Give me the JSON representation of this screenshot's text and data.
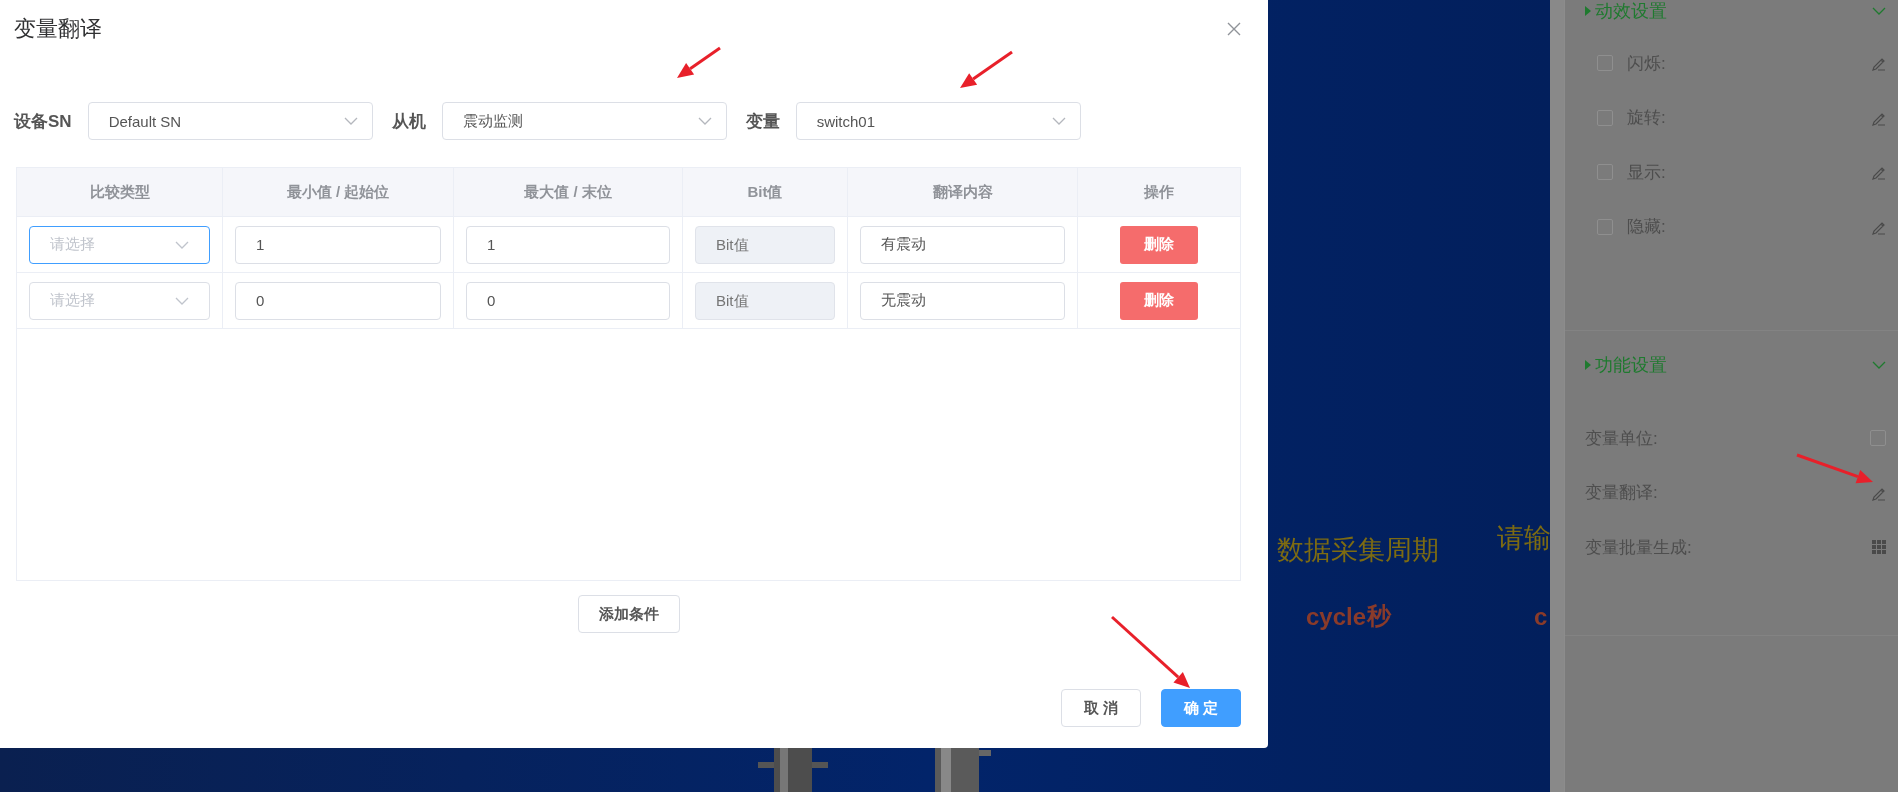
{
  "dialog": {
    "title": "变量翻译",
    "filters": [
      {
        "label": "设备SN",
        "value": "Default SN"
      },
      {
        "label": "从机",
        "value": "震动监测"
      },
      {
        "label": "变量",
        "value": "switch01"
      }
    ],
    "table": {
      "columns": [
        "比较类型",
        "最小值 / 起始位",
        "最大值 / 末位",
        "Bit值",
        "翻译内容",
        "操作"
      ],
      "rows": [
        {
          "compare_type": {
            "placeholder": "请选择",
            "focused": true
          },
          "min": "1",
          "max": "1",
          "bit": {
            "placeholder": "Bit值",
            "disabled": true
          },
          "translation": "有震动",
          "action": "删除"
        },
        {
          "compare_type": {
            "placeholder": "请选择",
            "focused": false
          },
          "min": "0",
          "max": "0",
          "bit": {
            "placeholder": "Bit值",
            "disabled": true
          },
          "translation": "无震动",
          "action": "删除"
        }
      ]
    },
    "add_button": "添加条件",
    "buttons": [
      {
        "label": "取 消",
        "kind": "default"
      },
      {
        "label": "确 定",
        "kind": "primary"
      }
    ]
  },
  "canvas": {
    "texts": [
      {
        "text": "数据采集周期",
        "kind": "label"
      },
      {
        "text": "请输",
        "kind": "label"
      },
      {
        "text": "cycle",
        "kind": "unit"
      },
      {
        "text": "秒",
        "kind": "unit"
      },
      {
        "text": "c",
        "kind": "unit"
      }
    ]
  },
  "panel": {
    "sections": [
      {
        "title": "动效设置",
        "items": [
          {
            "label": "闪烁:",
            "kind": "check-edit",
            "checked": false
          },
          {
            "label": "旋转:",
            "kind": "check-edit",
            "checked": false
          },
          {
            "label": "显示:",
            "kind": "check-edit",
            "checked": false
          },
          {
            "label": "隐藏:",
            "kind": "check-edit",
            "checked": false
          }
        ]
      },
      {
        "title": "功能设置",
        "items": [
          {
            "label": "变量单位:",
            "kind": "checkbox",
            "checked": false
          },
          {
            "label": "变量翻译:",
            "kind": "edit"
          },
          {
            "label": "变量批量生成:",
            "kind": "grid"
          }
        ]
      }
    ]
  }
}
